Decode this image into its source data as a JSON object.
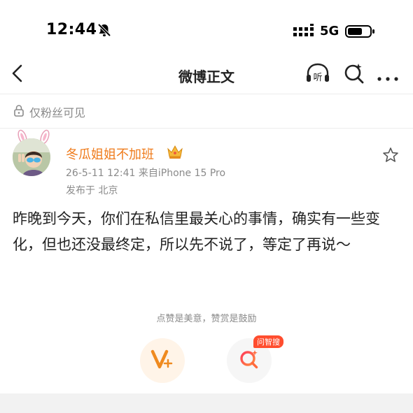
{
  "status_bar": {
    "time": "12:44",
    "network": "5G",
    "icons": [
      "bell-muted-icon",
      "signal-icon",
      "battery-icon"
    ]
  },
  "nav": {
    "title": "微博正文",
    "listen_label": "听",
    "icons": [
      "back-chevron-icon",
      "listen-icon",
      "search-icon",
      "more-icon"
    ]
  },
  "privacy": {
    "label": "仅粉丝可见",
    "icon": "lock-icon"
  },
  "post": {
    "author": "冬瓜姐姐不加班",
    "meta": "26-5-11 12:41  来自iPhone 15 Pro",
    "location": "发布于 北京",
    "content": "昨晚到今天，你们在私信里最关心的事情，确实有一些变化，但也还没最终定，所以先不说了，等定了再说～"
  },
  "support": {
    "hint": "点赞是美意，赞赏是鼓励",
    "ask_badge": "问智搜"
  },
  "colors": {
    "accent": "#ef7b1b",
    "muted": "#8a8a8a",
    "badge": "#ff4d2e"
  }
}
